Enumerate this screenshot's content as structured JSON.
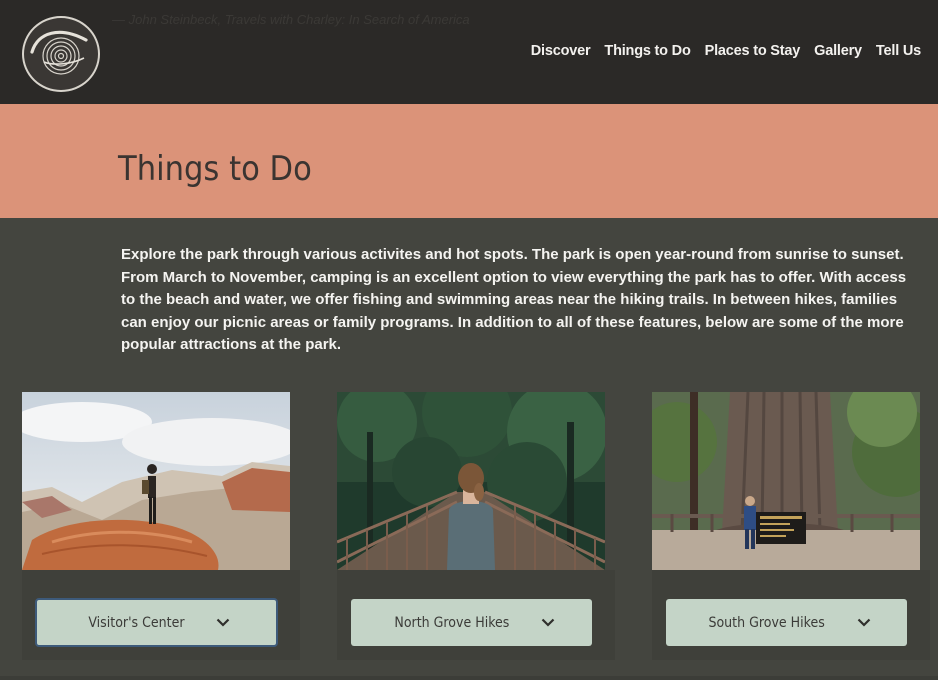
{
  "header": {
    "ghost_quote": "— John Steinbeck, Travels with Charley: In Search of America",
    "logo_alt": "Calaveras Big Trees State Park",
    "nav": [
      {
        "label": "Discover"
      },
      {
        "label": "Things to Do"
      },
      {
        "label": "Places to Stay"
      },
      {
        "label": "Gallery"
      },
      {
        "label": "Tell Us"
      }
    ]
  },
  "banner": {
    "title": "Things to Do",
    "color": "#db9379"
  },
  "intro": {
    "text": "Explore the park through various activites and hot spots. The park is open year-round from sunrise to sunset. From March to November, camping is an excellent option to view everything the park has to offer. With access to the beach and water, we offer fishing and swimming areas near the hiking trails. In between hikes, families can enjoy our picnic areas or family programs. In addition to all of these features, below are some of the more popular attractions at the park."
  },
  "cards": [
    {
      "label": "Visitor's Center",
      "icon": "chevron-down-icon",
      "focused": true,
      "photo": "hiker-on-rock-photo"
    },
    {
      "label": "North Grove Hikes",
      "icon": "chevron-down-icon",
      "focused": false,
      "photo": "bridge-forest-photo"
    },
    {
      "label": "South Grove Hikes",
      "icon": "chevron-down-icon",
      "focused": false,
      "photo": "giant-sequoia-photo"
    }
  ],
  "colors": {
    "header_bg": "#2b2927",
    "body_bg": "#44453f",
    "button_bg": "#c4d4c7"
  }
}
